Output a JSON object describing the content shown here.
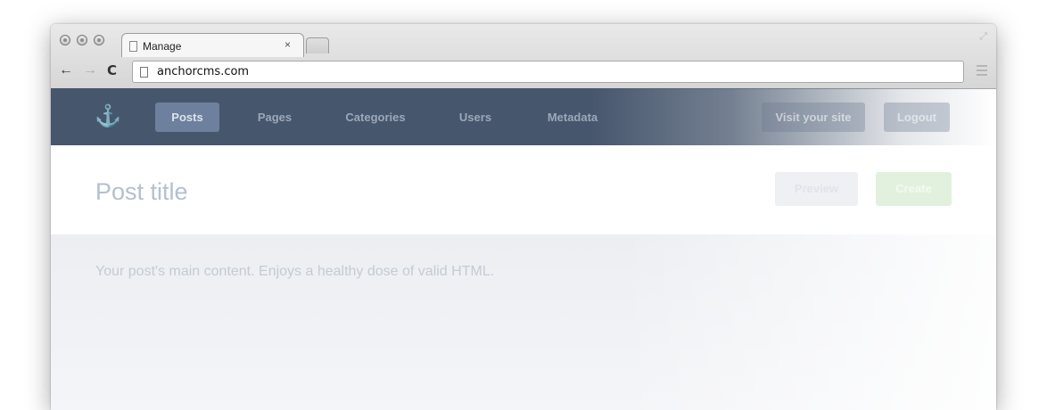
{
  "browser": {
    "tab_title": "Manage",
    "tab_close": "×",
    "url": "anchorcms.com",
    "icons": [
      "window-close-icon",
      "window-minimize-icon",
      "window-zoom-icon",
      "back-arrow-icon",
      "forward-arrow-icon",
      "reload-icon",
      "page-icon",
      "menu-icon",
      "fullscreen-icon"
    ],
    "back_glyph": "←",
    "forward_glyph": "→",
    "reload_glyph": "C"
  },
  "nav": {
    "logo_glyph": "⚓",
    "items": [
      {
        "label": "Posts",
        "active": true
      },
      {
        "label": "Pages",
        "active": false
      },
      {
        "label": "Categories",
        "active": false
      },
      {
        "label": "Users",
        "active": false
      },
      {
        "label": "Metadata",
        "active": false
      }
    ],
    "visit_site": "Visit your site",
    "logout": "Logout"
  },
  "editor": {
    "title_placeholder": "Post title",
    "preview_label": "Preview",
    "create_label": "Create",
    "content_placeholder": "Your post's main content. Enjoys a healthy dose of valid HTML."
  },
  "colors": {
    "nav_bg": "#46566d",
    "active_tab": "#6d809d",
    "create_green": "#e2f1dd"
  }
}
